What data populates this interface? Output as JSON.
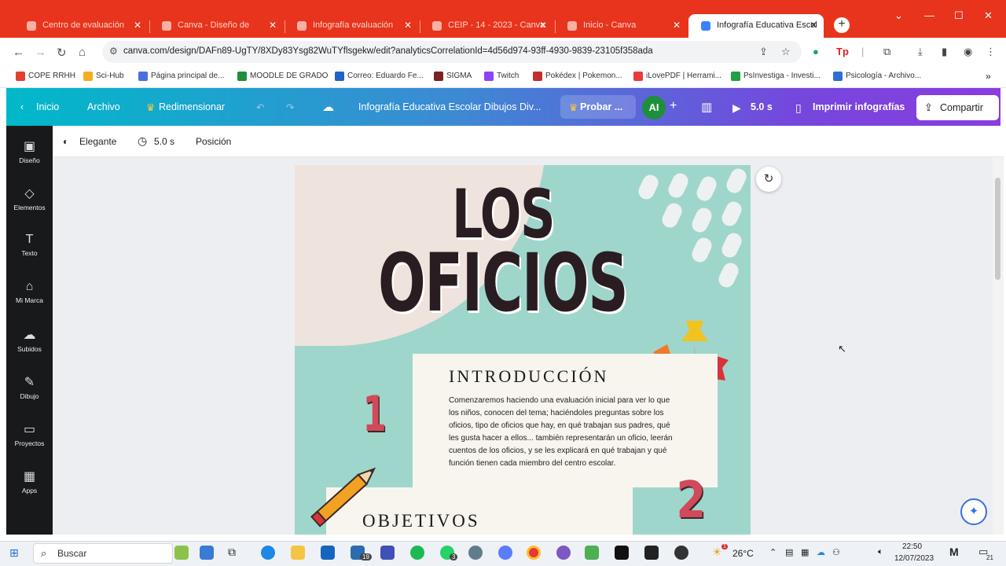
{
  "browser": {
    "tabs": [
      {
        "label": "Centro de evaluación",
        "active": false
      },
      {
        "label": "Canva - Diseño de",
        "active": false
      },
      {
        "label": "Infografía evaluación",
        "active": false
      },
      {
        "label": "CEIP - 14 - 2023 - Canva",
        "active": false
      },
      {
        "label": "Inicio - Canva",
        "active": false
      },
      {
        "label": "Infografía Educativa Escol",
        "active": true
      }
    ],
    "new_tab": "+",
    "url": "canva.com/design/DAFn89-UgTY/8XDy83Ysg82WuTYflsgekw/edit?analyticsCorrelationId=4d56d974-93ff-4930-9839-23105f358ada",
    "bookmarks": [
      {
        "label": "COPE RRHH",
        "color": "#e4402f"
      },
      {
        "label": "Sci-Hub",
        "color": "#f2b01e"
      },
      {
        "label": "Página principal de...",
        "color": "#4c6fe0"
      },
      {
        "label": "MOODLE DE GRADO",
        "color": "#1f8f3a"
      },
      {
        "label": "Correo: Eduardo Fe...",
        "color": "#1f64c8"
      },
      {
        "label": "SIGMA",
        "color": "#7a2222"
      },
      {
        "label": "Twitch",
        "color": "#8b44f7"
      },
      {
        "label": "Pokédex | Pokemon...",
        "color": "#c22f2f"
      },
      {
        "label": "iLovePDF | Herrami...",
        "color": "#e83c3c"
      },
      {
        "label": "PsInvestiga - Investi...",
        "color": "#22a043"
      },
      {
        "label": "Psicología - Archivo...",
        "color": "#2e6fd1"
      }
    ]
  },
  "canva": {
    "home": "Inicio",
    "file": "Archivo",
    "resize": "Redimensionar",
    "design_title": "Infografía Educativa Escolar Dibujos Div...",
    "try_pro": "Probar ...",
    "avatar": "AI",
    "duration": "5.0 s",
    "print": "Imprimir infografías",
    "share": "Compartir",
    "rail": [
      "Diseño",
      "Elementos",
      "Texto",
      "Mi Marca",
      "Subidos",
      "Dibujo",
      "Proyectos",
      "Apps"
    ],
    "context": {
      "animation": "Elegante",
      "duration": "5.0 s",
      "position": "Posición"
    }
  },
  "design": {
    "title_line1": "LOS",
    "title_line2": "OFICIOS",
    "number1": "1",
    "number2": "2",
    "intro_heading": "INTRODUCCIÓN",
    "intro_text": "Comenzaremos haciendo una evaluación inicial para ver lo que los niños, conocen del tema; haciéndoles preguntas sobre los oficios, tipo de oficios que hay, en qué trabajan sus padres, qué les gusta hacer a ellos... también representarán un oficio, leerán cuentos de los oficios, y se les explicará en qué trabajan y qué función tienen cada miembro del centro escolar.",
    "objectives_heading": "OBJETIVOS"
  },
  "taskbar": {
    "search": "Buscar",
    "mail_badge": "19",
    "whatsapp_badge": "3",
    "weather_badge": "1",
    "temperature": "26°C",
    "time": "22:50",
    "date": "12/07/2023",
    "notif_count": "21"
  }
}
